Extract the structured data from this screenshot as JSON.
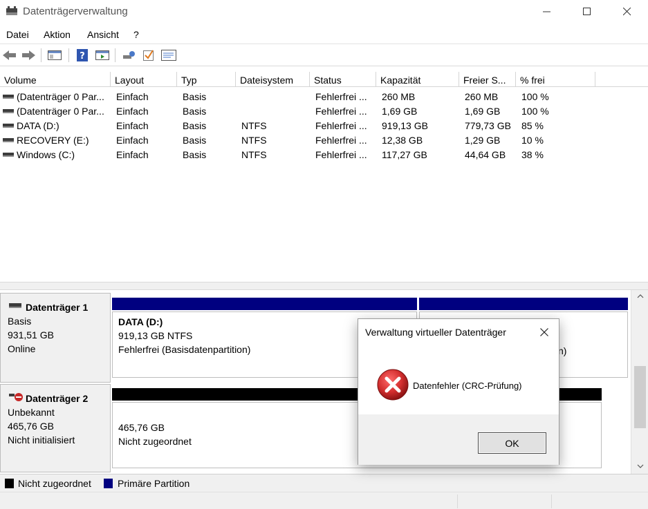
{
  "window": {
    "title": "Datenträgerverwaltung"
  },
  "menu": {
    "items": [
      "Datei",
      "Aktion",
      "Ansicht",
      "?"
    ]
  },
  "toolbar": {
    "icons": [
      "back-arrow-icon",
      "forward-arrow-icon",
      "console-tree-icon",
      "help-icon",
      "show-pane-icon",
      "connect-icon",
      "check-icon",
      "properties-icon"
    ]
  },
  "volume_list": {
    "columns": [
      "Volume",
      "Layout",
      "Typ",
      "Dateisystem",
      "Status",
      "Kapazität",
      "Freier S...",
      "% frei"
    ],
    "rows": [
      {
        "volume": "(Datenträger 0 Par...",
        "layout": "Einfach",
        "typ": "Basis",
        "dateisystem": "",
        "status": "Fehlerfrei ...",
        "kapazitaet": "260 MB",
        "frei": "260 MB",
        "prozent": "100 %"
      },
      {
        "volume": "(Datenträger 0 Par...",
        "layout": "Einfach",
        "typ": "Basis",
        "dateisystem": "",
        "status": "Fehlerfrei ...",
        "kapazitaet": "1,69 GB",
        "frei": "1,69 GB",
        "prozent": "100 %"
      },
      {
        "volume": "DATA (D:)",
        "layout": "Einfach",
        "typ": "Basis",
        "dateisystem": "NTFS",
        "status": "Fehlerfrei ...",
        "kapazitaet": "919,13 GB",
        "frei": "779,73 GB",
        "prozent": "85 %"
      },
      {
        "volume": "RECOVERY (E:)",
        "layout": "Einfach",
        "typ": "Basis",
        "dateisystem": "NTFS",
        "status": "Fehlerfrei ...",
        "kapazitaet": "12,38 GB",
        "frei": "1,29 GB",
        "prozent": "10 %"
      },
      {
        "volume": "Windows (C:)",
        "layout": "Einfach",
        "typ": "Basis",
        "dateisystem": "NTFS",
        "status": "Fehlerfrei ...",
        "kapazitaet": "117,27 GB",
        "frei": "44,64 GB",
        "prozent": "38 %"
      }
    ]
  },
  "disks": [
    {
      "name": "Datenträger 1",
      "type": "Basis",
      "size": "931,51 GB",
      "state": "Online",
      "partition": {
        "title": "DATA  (D:)",
        "size_fs": "919,13 GB NTFS",
        "status": "Fehlerfrei (Basisdatenpartition)"
      },
      "partition2_tail": "n)"
    },
    {
      "name": "Datenträger 2",
      "type": "Unbekannt",
      "size": "465,76 GB",
      "state": "Nicht initialisiert",
      "partition": {
        "size": "465,76 GB",
        "status": "Nicht zugeordnet"
      }
    }
  ],
  "legend": {
    "items": [
      {
        "label": "Nicht zugeordnet",
        "color": "#000000"
      },
      {
        "label": "Primäre Partition",
        "color": "#000080"
      }
    ]
  },
  "dialog": {
    "title": "Verwaltung virtueller Datenträger",
    "message": "Datenfehler (CRC-Prüfung)",
    "ok_label": "OK",
    "icon": "error-icon"
  },
  "colors": {
    "primary_partition": "#000080",
    "unallocated": "#000000",
    "error_red": "#d32f2f"
  }
}
